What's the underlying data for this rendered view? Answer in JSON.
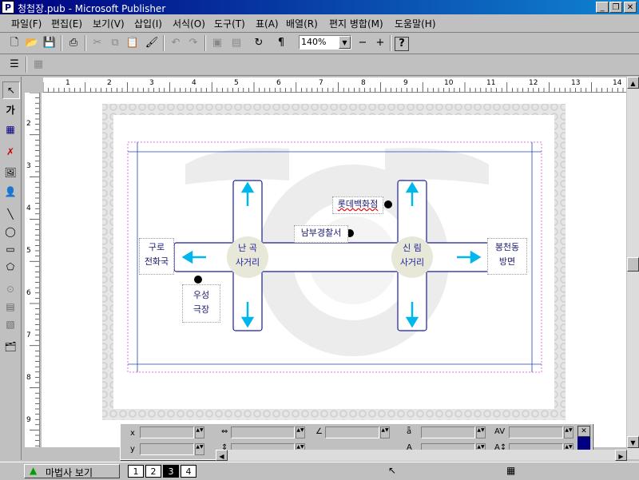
{
  "window": {
    "title": "청첩장.pub - Microsoft Publisher",
    "app_icon": "P"
  },
  "menu": [
    "파일(F)",
    "편집(E)",
    "보기(V)",
    "삽입(I)",
    "서식(O)",
    "도구(T)",
    "표(A)",
    "배열(R)",
    "편지 병합(M)",
    "도움말(H)"
  ],
  "toolbar": {
    "zoom": "140%"
  },
  "ruler": {
    "h_ticks": [
      "1",
      "2",
      "3",
      "4",
      "5",
      "6",
      "7",
      "8",
      "9",
      "10",
      "11",
      "12",
      "13",
      "14"
    ],
    "v_ticks": [
      "2",
      "3",
      "4",
      "5",
      "6",
      "7",
      "8",
      "9"
    ]
  },
  "map": {
    "left_label_line1": "구로",
    "left_label_line2": "전화국",
    "right_label_line1": "봉천동",
    "right_label_line2": "방면",
    "left_circle_line1": "난 곡",
    "left_circle_line2": "사거리",
    "right_circle_line1": "신 림",
    "right_circle_line2": "사거리",
    "lotte": "롯데백화점",
    "police": "남부경찰서",
    "theater_line1": "우성",
    "theater_line2": "극장"
  },
  "measure": {
    "x_label": "x",
    "y_label": "y"
  },
  "status": {
    "wizard_button": "마법사 보기",
    "pages": [
      "1",
      "2",
      "3",
      "4"
    ],
    "current_page": "3"
  },
  "colors": {
    "title_start": "#000080",
    "accent": "#00b7eb",
    "map_line": "#1a1aa0"
  }
}
